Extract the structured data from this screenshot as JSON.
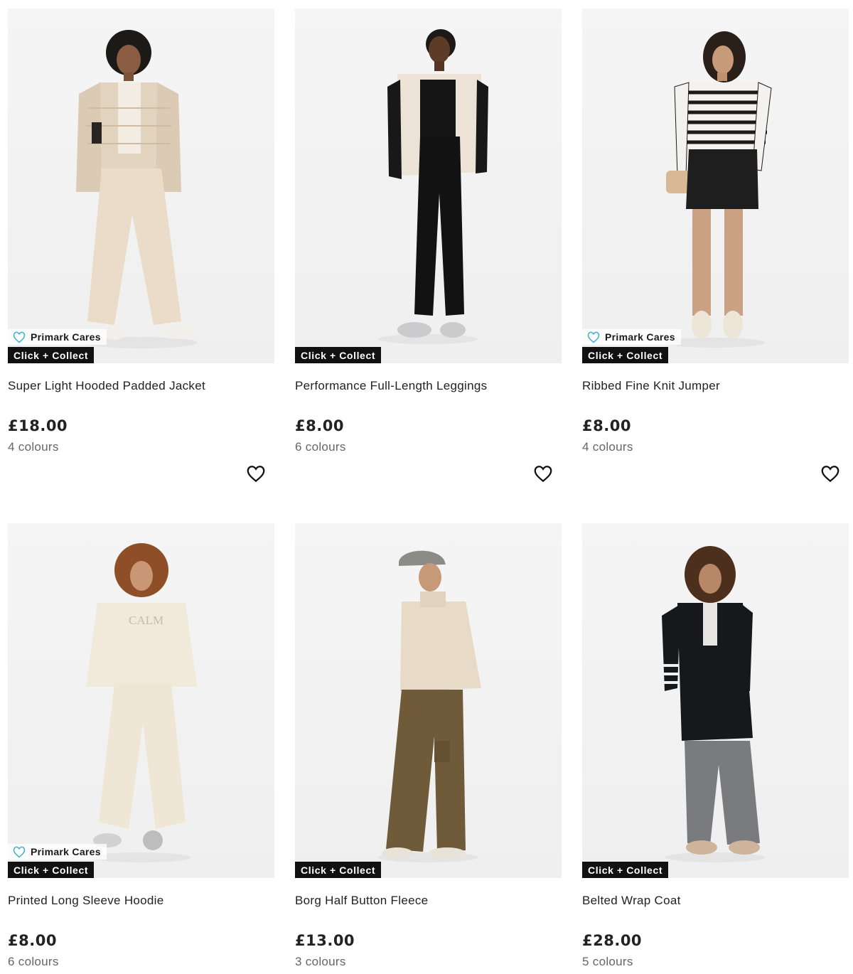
{
  "products": [
    {
      "title": "Super Light Hooded Padded Jacket",
      "price": "£18.00",
      "colours": "4 colours",
      "badge_cares": "Primark Cares",
      "badge_collect": "Click + Collect"
    },
    {
      "title": "Performance Full-Length Leggings",
      "price": "£8.00",
      "colours": "6 colours",
      "badge_cares": null,
      "badge_collect": "Click + Collect"
    },
    {
      "title": "Ribbed Fine Knit Jumper",
      "price": "£8.00",
      "colours": "4 colours",
      "badge_cares": "Primark Cares",
      "badge_collect": "Click + Collect"
    },
    {
      "title": "Printed Long Sleeve Hoodie",
      "price": "£8.00",
      "colours": "6 colours",
      "badge_cares": "Primark Cares",
      "badge_collect": "Click + Collect"
    },
    {
      "title": "Borg Half Button Fleece",
      "price": "£13.00",
      "colours": "3 colours",
      "badge_cares": null,
      "badge_collect": "Click + Collect"
    },
    {
      "title": "Belted Wrap Coat",
      "price": "£28.00",
      "colours": "5 colours",
      "badge_cares": null,
      "badge_collect": "Click + Collect"
    }
  ],
  "icons": {
    "wishlist": "heart-outline-icon",
    "cares": "heart-cares-icon"
  },
  "colors": {
    "collect_badge_bg": "#111111",
    "cares_heart": "#3bb3c8",
    "price_text": "#222222",
    "muted_text": "#666666"
  }
}
